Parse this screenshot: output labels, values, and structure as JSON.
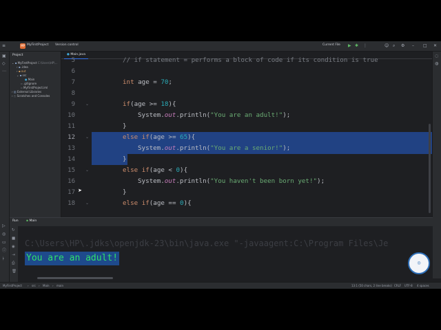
{
  "titlebar": {
    "project_badge": "MP",
    "project_name": "MyFirstProject",
    "vcs": "Version control",
    "run_config": "Current File"
  },
  "project_panel": {
    "title": "Project",
    "items": [
      {
        "label": "MyFirstProject",
        "suffix": "C:\\Users\\HP\\..."
      },
      {
        "label": ".idea"
      },
      {
        "label": "out"
      },
      {
        "label": "src"
      },
      {
        "label": "Main"
      },
      {
        "label": ".gitignore"
      },
      {
        "label": "MyFirstProject.iml"
      },
      {
        "label": "External Libraries"
      },
      {
        "label": "Scratches and Consoles"
      }
    ]
  },
  "editor": {
    "tab": "Main.java",
    "line_numbers": [
      "5",
      "6",
      "7",
      "8",
      "9",
      "10",
      "11",
      "12",
      "13",
      "14",
      "15",
      "16",
      "17",
      "18"
    ],
    "lines": [
      "// if statement = performs a block of code if its condition is true",
      "",
      "int age = 70;",
      "",
      "if(age >= 18){",
      "System.out.println(\"You are an adult!\");",
      "}",
      "else if(age >= 65){",
      "System.out.println(\"You are a senior!\");",
      "}",
      "else if(age < 0){",
      "System.out.println(\"You haven't been born yet!\");",
      "}",
      "else if(age == 0){"
    ]
  },
  "run_panel": {
    "tab_run": "Run",
    "tab_main": "Main",
    "command": "C:\\Users\\HP\\.jdks\\openjdk-23\\bin\\java.exe \"-javaagent:C:\\Program Files\\Je",
    "output": "You are an adult!"
  },
  "statusbar": {
    "breadcrumb": [
      "MyFirstProject",
      "src",
      "Main",
      "main"
    ],
    "position": "13:1 (50 chars, 2 line breaks)",
    "line_sep": "CRLF",
    "encoding": "UTF-8",
    "indent": "4 spaces"
  },
  "colors": {
    "selection": "#214283",
    "keyword": "#cf8e6d",
    "string": "#6aab73",
    "number": "#2aacb8",
    "comment": "#7a7e85",
    "console_output": "#2fe06b"
  }
}
